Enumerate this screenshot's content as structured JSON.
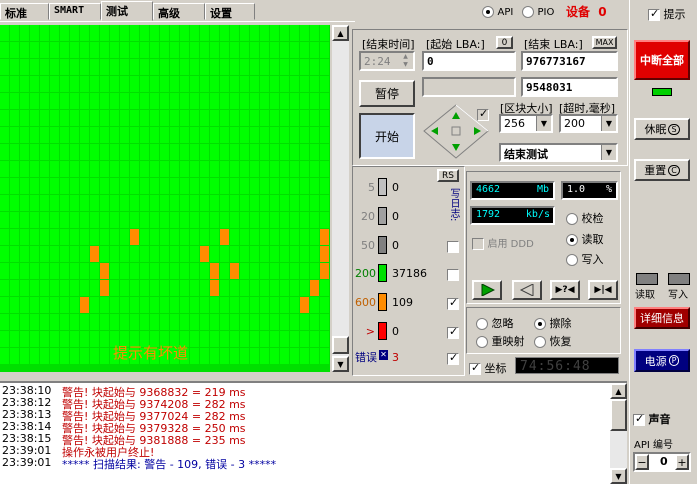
{
  "tabs": [
    "标准",
    "SMART",
    "测试",
    "高级",
    "设置"
  ],
  "mode": {
    "api": "API",
    "pio": "PIO",
    "device_label": "设备",
    "device_num": "0"
  },
  "hint": {
    "label": "提示"
  },
  "params": {
    "end_time_label": "[结束时间]",
    "end_time_value": "2:24",
    "start_lba_label": "[起始 LBA:]",
    "start_lba_btn": "0",
    "start_lba_value": "0",
    "end_lba_label": "[结束 LBA:]",
    "end_lba_btn": "MAX",
    "end_lba_value": "976773167",
    "current_lba": "9548031",
    "pause": "暂停",
    "start": "开始",
    "block_size_label": "[区块大小]",
    "block_size_value": "256",
    "timeout_label": "[超时,毫秒]",
    "timeout_value": "200",
    "end_test": "结束测试"
  },
  "stats": {
    "rs_button": "RS",
    "rows": [
      {
        "label": "5",
        "count": "0",
        "color": "#c0c0c0"
      },
      {
        "label": "20",
        "count": "0",
        "color": "#a0a0a0"
      },
      {
        "label": "50",
        "count": "0",
        "color": "#808080"
      },
      {
        "label": "200",
        "count": "37186",
        "color": "#00e000"
      },
      {
        "label": "600",
        "count": "109",
        "color": "#ff8c00"
      },
      {
        "label": ">",
        "count": "0",
        "color": "#ff0000"
      }
    ],
    "error_label": "错误",
    "error_count": "3",
    "vertical_label": "写日志:"
  },
  "speed": {
    "mb_value": "4662",
    "mb_unit": "Mb",
    "percent_value": "1.0",
    "percent_unit": "%",
    "kbs_value": "1792",
    "kbs_unit": "kb/s",
    "verify": "校检",
    "read": "读取",
    "write": "写入",
    "enable_ddd": "启用 DDD"
  },
  "actions": {
    "ignore": "忽略",
    "erase": "擦除",
    "remap": "重映射",
    "restore": "恢复",
    "coords_label": "坐标",
    "clock": "74:56:48"
  },
  "grid": {
    "overlay_text": "提示有坏道"
  },
  "right_panel": {
    "abort_all": "中断全部",
    "sleep": "休眠",
    "reset": "重置",
    "read": "读取",
    "write": "写入",
    "details": "详细信息",
    "power": "电源",
    "sound": "声音",
    "api_num_label": "API 编号",
    "api_num_value": "0",
    "sleep_key": "S",
    "reset_key": "C",
    "power_key": "P",
    "minus": "−",
    "plus": "+"
  },
  "log": [
    {
      "time": "23:38:10",
      "message": "警告! 块起始与 9368832 = 219 ms",
      "color": "#c00000"
    },
    {
      "time": "23:38:12",
      "message": "警告! 块起始与 9374208 = 282 ms",
      "color": "#c00000"
    },
    {
      "time": "23:38:13",
      "message": "警告! 块起始与 9377024 = 282 ms",
      "color": "#c00000"
    },
    {
      "time": "23:38:14",
      "message": "警告! 块起始与 9379328 = 250 ms",
      "color": "#c00000"
    },
    {
      "time": "23:38:15",
      "message": "警告! 块起始与 9381888 = 235 ms",
      "color": "#c00000"
    },
    {
      "time": "23:39:01",
      "message": "操作永被用户终止!",
      "color": "#c00000"
    },
    {
      "time": "23:39:01",
      "message": "***** 扫描结果: 警告 - 109, 错误 - 3 *****",
      "color": "#0000a0"
    }
  ]
}
